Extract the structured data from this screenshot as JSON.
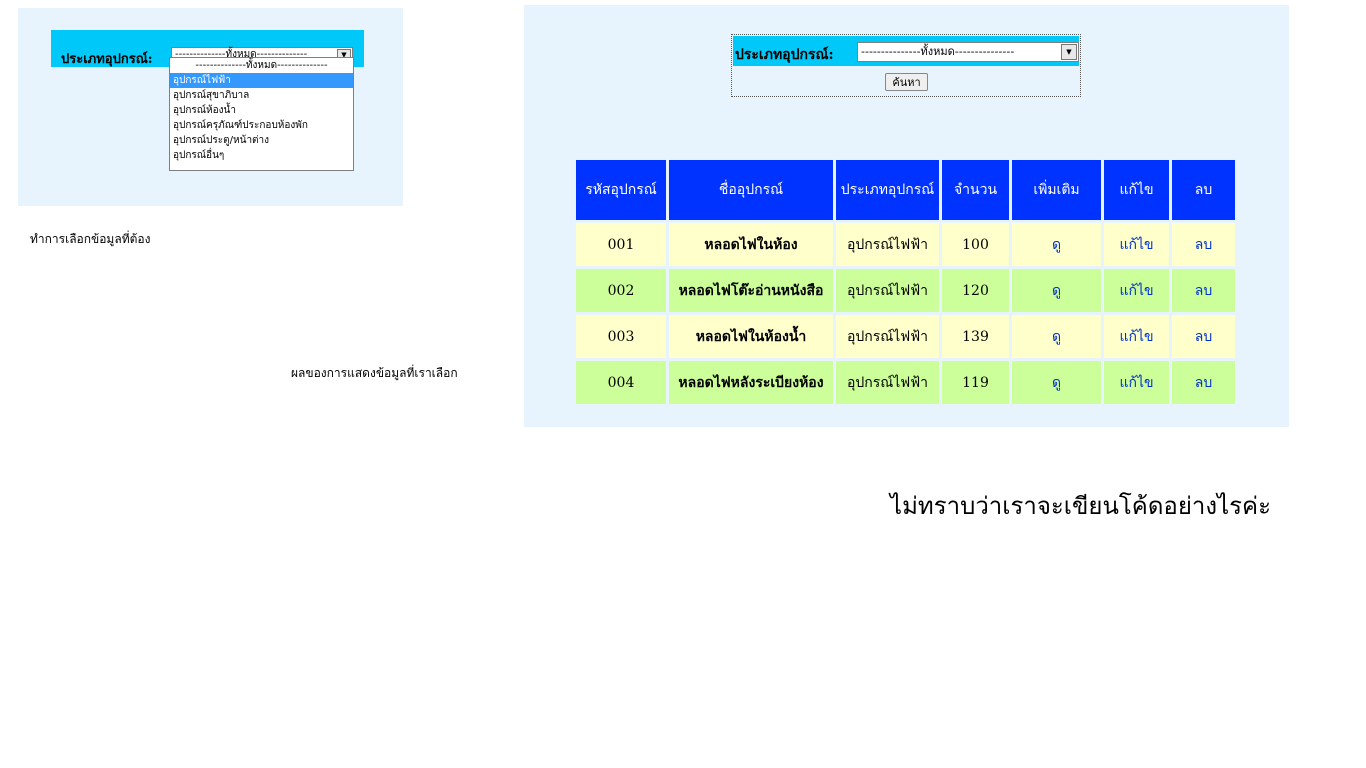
{
  "left_panel": {
    "filter_label": "ประเภทอุปกรณ์:",
    "select_value": "--------------ทั้งหมด--------------",
    "options": [
      "--------------ทั้งหมด--------------",
      "อุปกรณ์ไฟฟ้า",
      "อุปกรณ์สุขาภิบาล",
      "อุปกรณ์ห้องน้ำ",
      "อุปกรณ์ครุภัณฑ์ประกอบห้องพัก",
      "อุปกรณ์ประตู/หน้าต่าง",
      "อุปกรณ์อื่นๆ"
    ],
    "highlighted_index": 1
  },
  "captions": {
    "left": "ทำการเลือกข้อมูลที่ต้อง",
    "middle": "ผลของการแสดงข้อมูลที่เราเลือก"
  },
  "right_panel": {
    "filter_label": "ประเภทอุปกรณ์:",
    "select_value": "---------------ทั้งหมด---------------",
    "search_button": "ค้นหา",
    "table": {
      "headers": [
        "รหัสอุปกรณ์",
        "ชื่ออุปกรณ์",
        "ประเภทอุปกรณ์",
        "จำนวน",
        "เพิ่มเติม",
        "แก้ไข",
        "ลบ"
      ],
      "rows": [
        {
          "code": "001",
          "name": "หลอดไฟในห้อง",
          "type": "อุปกรณ์ไฟฟ้า",
          "qty": "100",
          "more": "ดู",
          "edit": "แก้ไข",
          "del": "ลบ"
        },
        {
          "code": "002",
          "name": "หลอดไฟโต๊ะอ่านหนังสือ",
          "type": "อุปกรณ์ไฟฟ้า",
          "qty": "120",
          "more": "ดู",
          "edit": "แก้ไข",
          "del": "ลบ"
        },
        {
          "code": "003",
          "name": "หลอดไฟในห้องน้ำ",
          "type": "อุปกรณ์ไฟฟ้า",
          "qty": "139",
          "more": "ดู",
          "edit": "แก้ไข",
          "del": "ลบ"
        },
        {
          "code": "004",
          "name": "หลอดไฟหลังระเบียงห้อง",
          "type": "อุปกรณ์ไฟฟ้า",
          "qty": "119",
          "more": "ดู",
          "edit": "แก้ไข",
          "del": "ลบ"
        }
      ]
    }
  },
  "question": "ไม่ทราบว่าเราจะเขียนโค้ดอย่างไรค่ะ",
  "colors": {
    "panel_bg": "#e8f4fd",
    "filter_bg": "#00c8f8",
    "header_bg": "#0033ff",
    "row_yellow": "#ffffcc",
    "row_green": "#ccff99",
    "link": "#0033cc",
    "highlight": "#3399ff"
  }
}
